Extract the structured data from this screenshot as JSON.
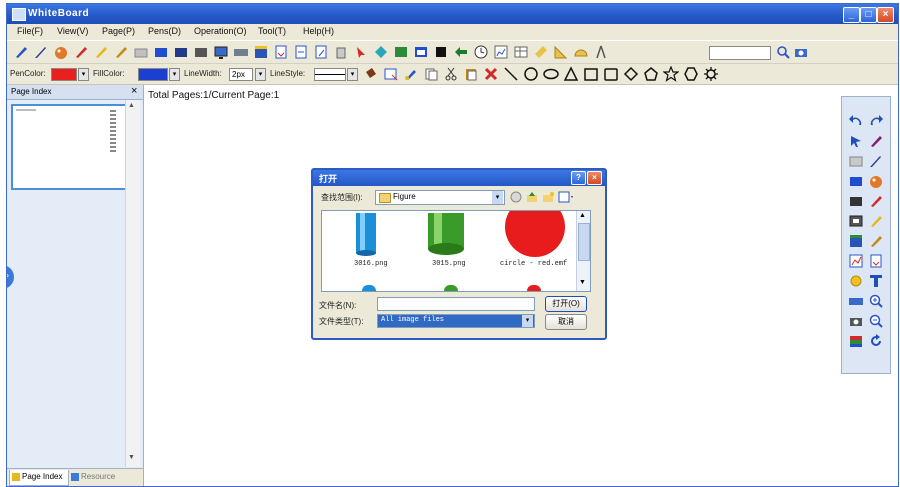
{
  "window": {
    "title": "WhiteBoard"
  },
  "menu": [
    "File(F)",
    "View(V)",
    "Page(P)",
    "Pens(D)",
    "Operation(O)",
    "Tool(T)",
    "Help(H)"
  ],
  "toolbar2": {
    "pen_color_label": "PenColor:",
    "fill_color_label": "FillColor:",
    "line_width_label": "LineWidth:",
    "line_width_value": "2px",
    "line_style_label": "LineStyle:",
    "pen_color": "#e82020",
    "fill_color": "#1c3fd0"
  },
  "left_panel": {
    "header": "Page Index",
    "close_glyph": "×",
    "tabs": [
      "Page Index",
      "Resource"
    ]
  },
  "canvas": {
    "page_info": "Total Pages:1/Current Page:1"
  },
  "dialog": {
    "title": "打开",
    "look_in_label": "查找范围(I):",
    "look_in_value": "Figure",
    "files": [
      {
        "name": "3016.png",
        "icon": "cylinder-blue"
      },
      {
        "name": "3015.png",
        "icon": "cylinder-green"
      },
      {
        "name": "circle - red.emf",
        "icon": "circle-red"
      }
    ],
    "filename_label": "文件名(N):",
    "filename_value": "",
    "filetype_label": "文件类型(T):",
    "filetype_value": "All image files",
    "open_button": "打开(O)",
    "cancel_button": "取消"
  }
}
